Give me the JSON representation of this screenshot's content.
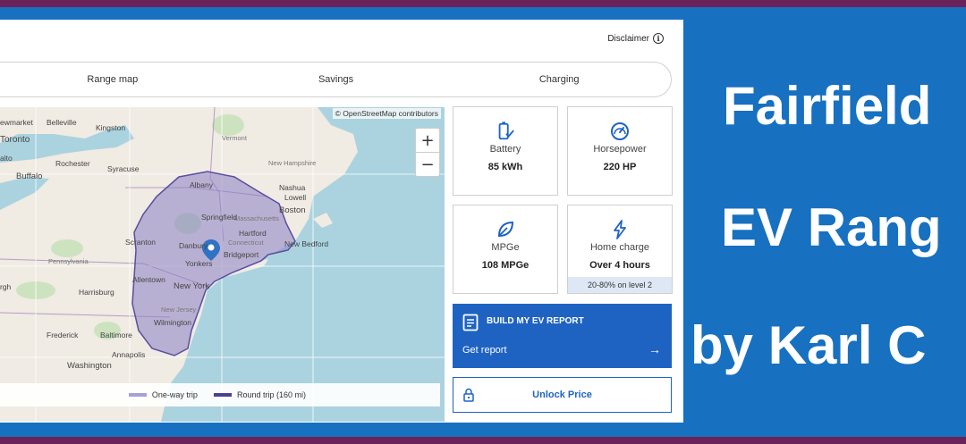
{
  "banner": {
    "line1": "Fairfield",
    "line2": "EV Rang",
    "line3": "by Karl C"
  },
  "header": {
    "disclaimer": "Disclaimer",
    "info_icon": "i"
  },
  "tabs": [
    {
      "label": "Range map"
    },
    {
      "label": "Savings"
    },
    {
      "label": "Charging"
    }
  ],
  "map": {
    "attribution": "© OpenStreetMap contributors",
    "zoom_in": "+",
    "zoom_out": "−",
    "legend": {
      "one_way": "One-way trip",
      "round_trip": "Round trip (160 mi)"
    },
    "places": {
      "newmarket": "ewmarket",
      "belleville": "Belleville",
      "kingston": "Kingston",
      "toronto": "Toronto",
      "alto": "alto",
      "rochester": "Rochester",
      "syracuse": "Syracuse",
      "buffalo": "Buffalo",
      "albany": "Albany",
      "nashua": "Nashua",
      "lowell": "Lowell",
      "boston": "Boston",
      "springfield": "Springfield",
      "hartford": "Hartford",
      "newbedford": "New Bedford",
      "danbury": "Danbury",
      "yonkers": "Yonkers",
      "bridgeport": "Bridgeport",
      "newyork": "New York",
      "scranton": "Scranton",
      "allentown": "Allentown",
      "harrisburg": "Harrisburg",
      "wilmington": "Wilmington",
      "frederick": "Frederick",
      "baltimore": "Baltimore",
      "annapolis": "Annapolis",
      "washington": "Washington",
      "vermont": "Vermont",
      "massachusetts": "Massachusetts",
      "newhampshire": "New Hampshire",
      "connecticut": "Connecticut",
      "pennsylvania": "Pennsylvania",
      "newjersey": "New Jersey",
      "rgh": "rgh"
    },
    "colors": {
      "water": "#aad3df",
      "land": "#f0ebe3",
      "range_fill": "#8b7fc4",
      "range_stroke": "#5a4ea0",
      "marker": "#3072c4"
    }
  },
  "stats": {
    "battery": {
      "label": "Battery",
      "value": "85 kWh",
      "icon": "battery-icon"
    },
    "horsepower": {
      "label": "Horsepower",
      "value": "220 HP",
      "icon": "gauge-icon"
    },
    "mpge": {
      "label": "MPGe",
      "value": "108 MPGe",
      "icon": "leaf-icon"
    },
    "home_charge": {
      "label": "Home charge",
      "value": "Over 4 hours",
      "note": "20-80% on level 2",
      "icon": "lightning-icon"
    }
  },
  "report": {
    "title": "BUILD MY EV REPORT",
    "subtitle": "Get report",
    "arrow": "→"
  },
  "unlock": {
    "label": "Unlock Price"
  },
  "colors": {
    "accent": "#1f63c2",
    "banner_blue": "#1770c0",
    "frame_purple": "#6a2358"
  }
}
